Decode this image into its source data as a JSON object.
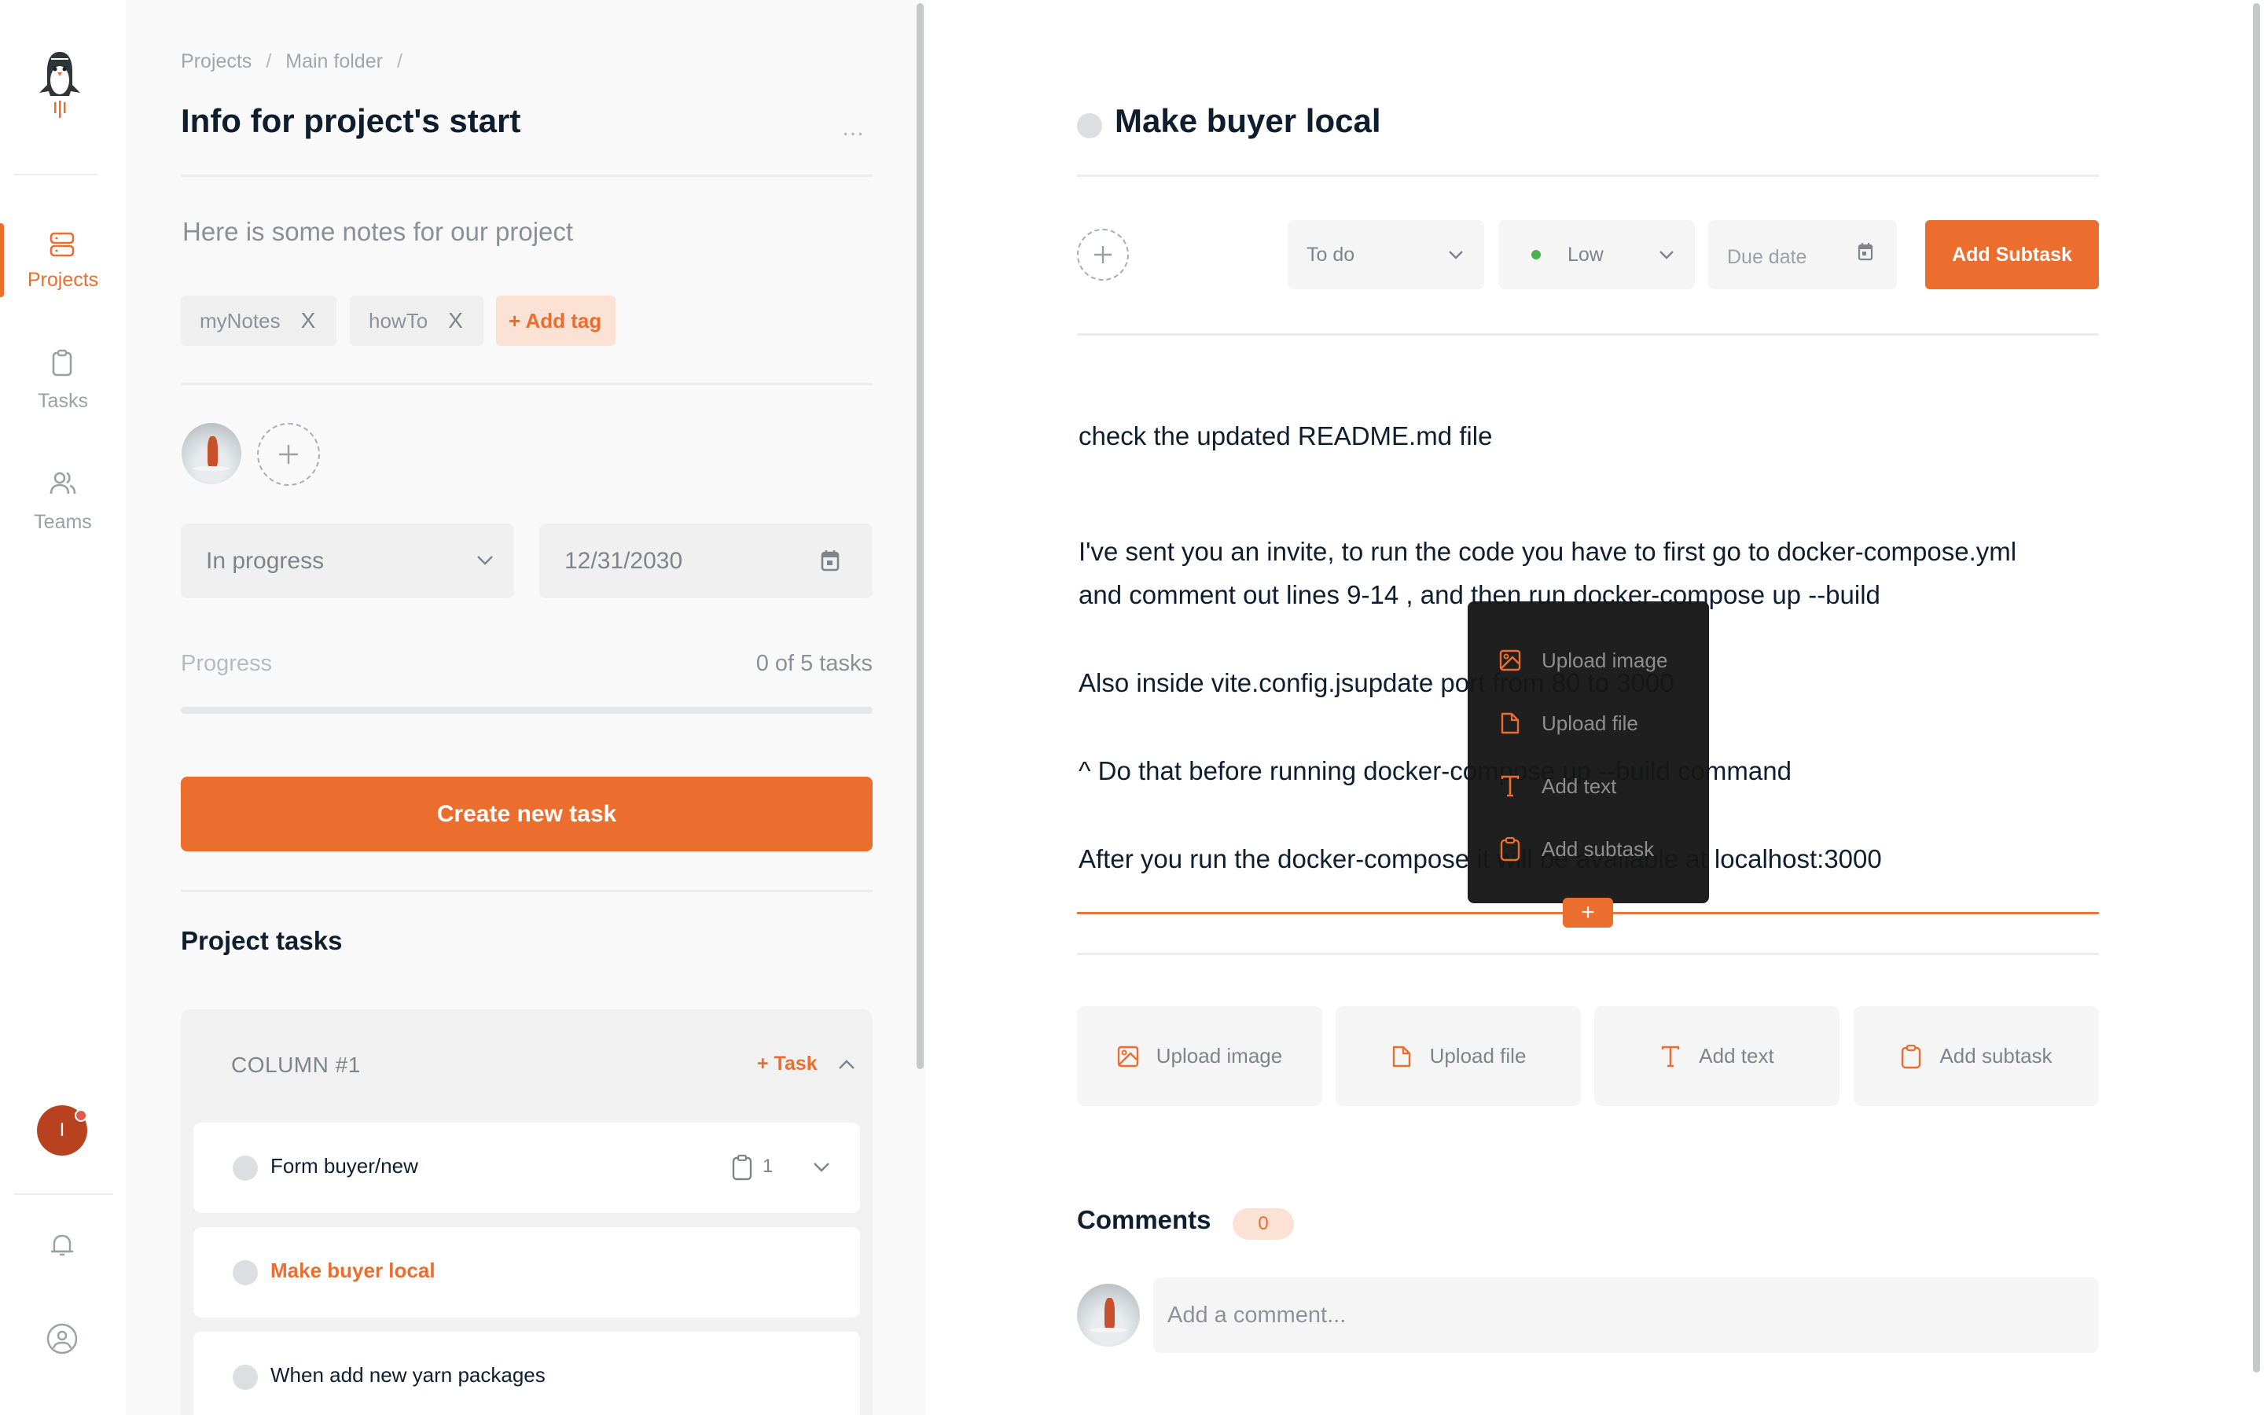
{
  "sidebar": {
    "logo": "penguin-rocket-logo",
    "items": [
      {
        "label": "Projects",
        "icon": "server-stack-icon",
        "active": true
      },
      {
        "label": "Tasks",
        "icon": "clipboard-icon",
        "active": false
      },
      {
        "label": "Teams",
        "icon": "users-icon",
        "active": false
      }
    ],
    "user_initial": "I",
    "bottom_icons": [
      "bell-icon",
      "user-circle-icon"
    ]
  },
  "project": {
    "breadcrumb": [
      "Projects",
      "Main folder"
    ],
    "breadcrumb_separator": "/",
    "title": "Info for project's start",
    "more_label": "…",
    "notes": "Here is some notes for our project",
    "tags": [
      {
        "label": "myNotes",
        "remove": "X"
      },
      {
        "label": "howTo",
        "remove": "X"
      }
    ],
    "add_tag_label": "+ Add tag",
    "status": "In progress",
    "due_date": "12/31/2030",
    "progress_label": "Progress",
    "progress_count": "0 of 5 tasks",
    "progress_fraction": 0,
    "create_button": "Create new task",
    "tasks_heading": "Project tasks",
    "column": {
      "title": "COLUMN #1",
      "add_task_label": "+ Task",
      "tasks": [
        {
          "name": "Form buyer/new",
          "subtask_count": "1",
          "active": false
        },
        {
          "name": "Make buyer local",
          "active": true
        },
        {
          "name": "When add new yarn packages",
          "active": false
        }
      ]
    }
  },
  "task": {
    "title": "Make buyer local",
    "status": "To do",
    "priority": "Low",
    "priority_color": "#4caf50",
    "due_date_placeholder": "Due date",
    "add_subtask_button": "Add Subtask",
    "content_lines": [
      "check the updated README.md file",
      "I've sent you an invite, to run the code you have to first go to docker-compose.yml",
      "and comment out lines 9-14 , and then run docker-compose up --build",
      "Also inside vite.config.jsupdate port from 80 to 3000",
      "^ Do that before running docker-compose up --build command",
      "After you run the docker-compose it will be available at localhost:3000"
    ],
    "insert_menu": [
      {
        "label": "Upload image",
        "icon": "image-icon"
      },
      {
        "label": "Upload file",
        "icon": "file-icon"
      },
      {
        "label": "Add text",
        "icon": "text-icon"
      },
      {
        "label": "Add subtask",
        "icon": "clipboard-icon"
      }
    ],
    "insert_button": "+",
    "actions": [
      {
        "label": "Upload image",
        "icon": "image-icon"
      },
      {
        "label": "Upload file",
        "icon": "file-icon"
      },
      {
        "label": "Add text",
        "icon": "text-icon"
      },
      {
        "label": "Add subtask",
        "icon": "clipboard-icon"
      }
    ],
    "comments_heading": "Comments",
    "comments_count": "0",
    "comment_placeholder": "Add a comment..."
  },
  "colors": {
    "accent": "#eb6e2f",
    "accent_soft": "#fbe2d5",
    "text_dark": "#0f1e2e",
    "muted": "#8b9096"
  }
}
